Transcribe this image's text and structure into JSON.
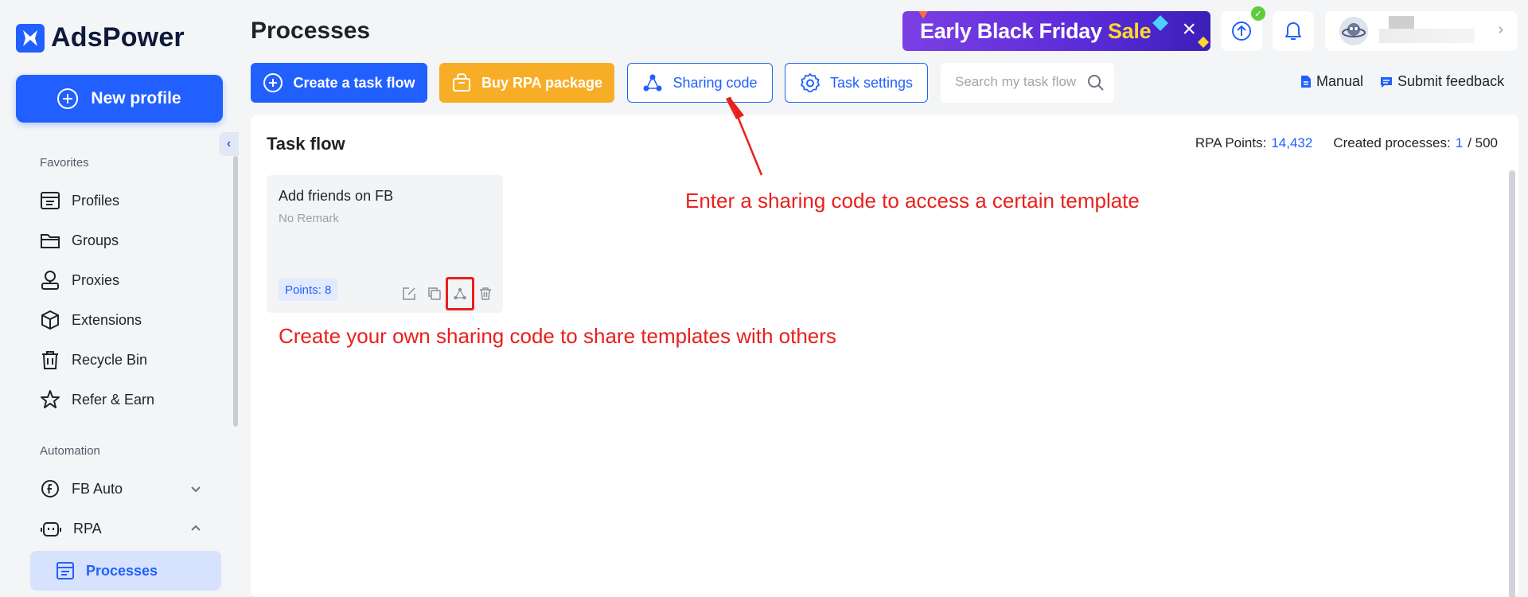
{
  "app": {
    "name": "AdsPower"
  },
  "sidebar": {
    "new_profile_label": "New profile",
    "favorites_label": "Favorites",
    "automation_label": "Automation",
    "items": [
      {
        "label": "Profiles",
        "icon": "profiles-icon"
      },
      {
        "label": "Groups",
        "icon": "folder-icon"
      },
      {
        "label": "Proxies",
        "icon": "proxies-icon"
      },
      {
        "label": "Extensions",
        "icon": "cube-icon"
      },
      {
        "label": "Recycle Bin",
        "icon": "trash-icon"
      },
      {
        "label": "Refer & Earn",
        "icon": "star-icon"
      }
    ],
    "automation_items": [
      {
        "label": "FB Auto",
        "icon": "facebook-icon"
      },
      {
        "label": "RPA",
        "icon": "robot-icon"
      }
    ],
    "active_item": "Processes"
  },
  "header": {
    "title": "Processes",
    "promo": {
      "text_main": "Early Black Friday ",
      "text_highlight": "Sale"
    },
    "update_badge": "✓"
  },
  "toolbar": {
    "create_label": "Create a task flow",
    "buy_label": "Buy RPA package",
    "sharing_label": "Sharing code",
    "settings_label": "Task settings",
    "search_placeholder": "Search my task flow",
    "manual_label": "Manual",
    "feedback_label": "Submit feedback"
  },
  "panel": {
    "title": "Task flow",
    "rpa_points_label": "RPA Points:",
    "rpa_points_value": "14,432",
    "created_label": "Created processes:",
    "created_value": "1",
    "created_max": "/ 500"
  },
  "card": {
    "title": "Add friends on FB",
    "remark": "No Remark",
    "points": "Points: 8"
  },
  "annotations": {
    "sharing_code": "Enter a sharing code to access a certain template",
    "create_code": "Create your own sharing code to share templates with others"
  },
  "colors": {
    "accent": "#2160ff",
    "warning": "#f7ad26",
    "annotation": "#e8201c"
  }
}
